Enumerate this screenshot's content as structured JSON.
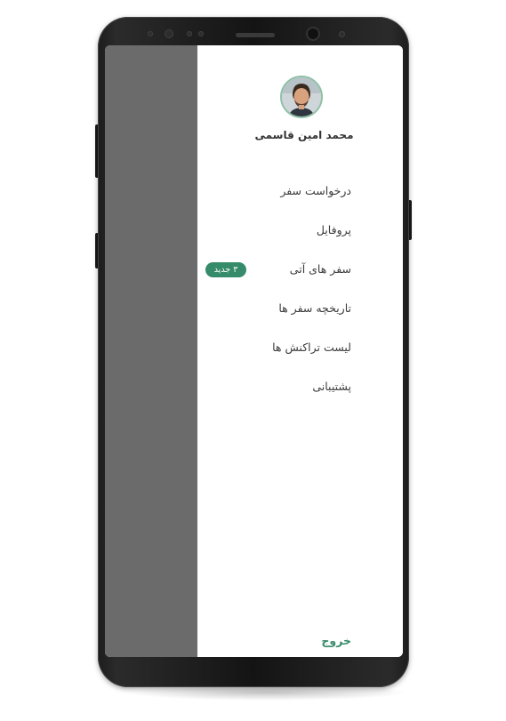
{
  "user": {
    "name": "محمد امین قاسمی"
  },
  "menu": {
    "items": [
      {
        "label": "درخواست سفر",
        "icon": "traveler-luggage-icon"
      },
      {
        "label": "پروفایل",
        "icon": "user-icon"
      },
      {
        "label": "سفر های آتی",
        "icon": "car-icon",
        "badge": "۳ جدید"
      },
      {
        "label": "تاریخچه سفر ها",
        "icon": "history-icon"
      },
      {
        "label": "لیست تراکنش ها",
        "icon": "receipt-icon"
      },
      {
        "label": "پشتیبانی",
        "icon": "support-agent-icon"
      }
    ],
    "logout_label": "خروج",
    "logout_icon": "logout-icon"
  },
  "colors": {
    "accent": "#368b6a",
    "overlay": "#6b6b6b",
    "text": "#3b3b3b"
  }
}
